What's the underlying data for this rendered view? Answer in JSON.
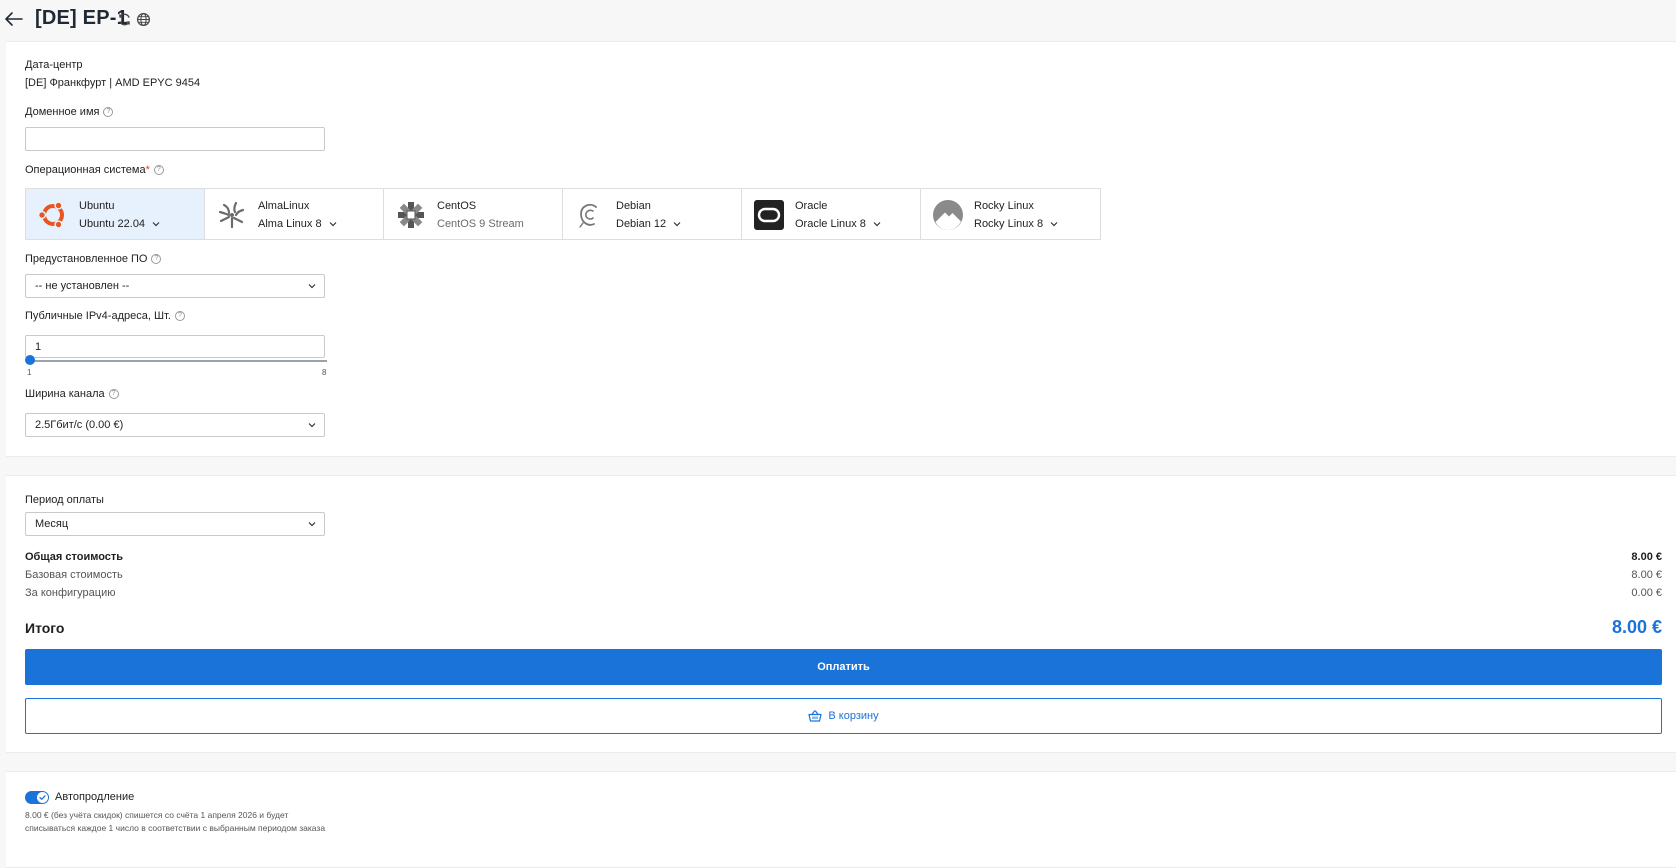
{
  "header": {
    "title": "[DE] EP-1"
  },
  "config": {
    "datacenter_label": "Дата-центр",
    "datacenter_value": "[DE] Франкфурт | AMD EPYC 9454",
    "domain_label": "Доменное имя",
    "domain_value": "",
    "os_label": "Операционная система",
    "os_required_mark": "*",
    "os_options": [
      {
        "name": "Ubuntu",
        "version": "Ubuntu 22.04",
        "has_dropdown": true,
        "selected": true
      },
      {
        "name": "AlmaLinux",
        "version": "Alma Linux 8",
        "has_dropdown": true,
        "selected": false
      },
      {
        "name": "CentOS",
        "version": "CentOS 9 Stream",
        "has_dropdown": false,
        "selected": false
      },
      {
        "name": "Debian",
        "version": "Debian 12",
        "has_dropdown": true,
        "selected": false
      },
      {
        "name": "Oracle",
        "version": "Oracle Linux 8",
        "has_dropdown": true,
        "selected": false
      },
      {
        "name": "Rocky Linux",
        "version": "Rocky Linux 8",
        "has_dropdown": true,
        "selected": false
      }
    ],
    "software_label": "Предустановленное ПО",
    "software_value": "-- не установлен --",
    "ipv4_label": "Публичные IPv4-адреса, Шт.",
    "ipv4_value": "1",
    "ipv4_min": "1",
    "ipv4_max": "8",
    "bandwidth_label": "Ширина канала",
    "bandwidth_value": "2.5Гбит/с (0.00 €)"
  },
  "billing": {
    "period_label": "Период оплаты",
    "period_value": "Месяц",
    "total_cost_label": "Общая стоимость",
    "total_cost_value": "8.00 €",
    "base_cost_label": "Базовая стоимость",
    "base_cost_value": "8.00 €",
    "config_cost_label": "За конфигурацию",
    "config_cost_value": "0.00 €",
    "grand_total_label": "Итого",
    "grand_total_value": "8.00 €",
    "pay_label": "Оплатить",
    "cart_label": "В корзину"
  },
  "autorenew": {
    "label": "Автопродление",
    "enabled": true,
    "description": "8.00 € (без учёта скидок) спишется со счёта 1 апреля 2026 и будет списываться каждое 1 число в соответствии с выбранным периодом заказа"
  },
  "colors": {
    "accent": "#1a73d9",
    "selected_bg": "#e7f0fd",
    "required": "#e53935"
  }
}
